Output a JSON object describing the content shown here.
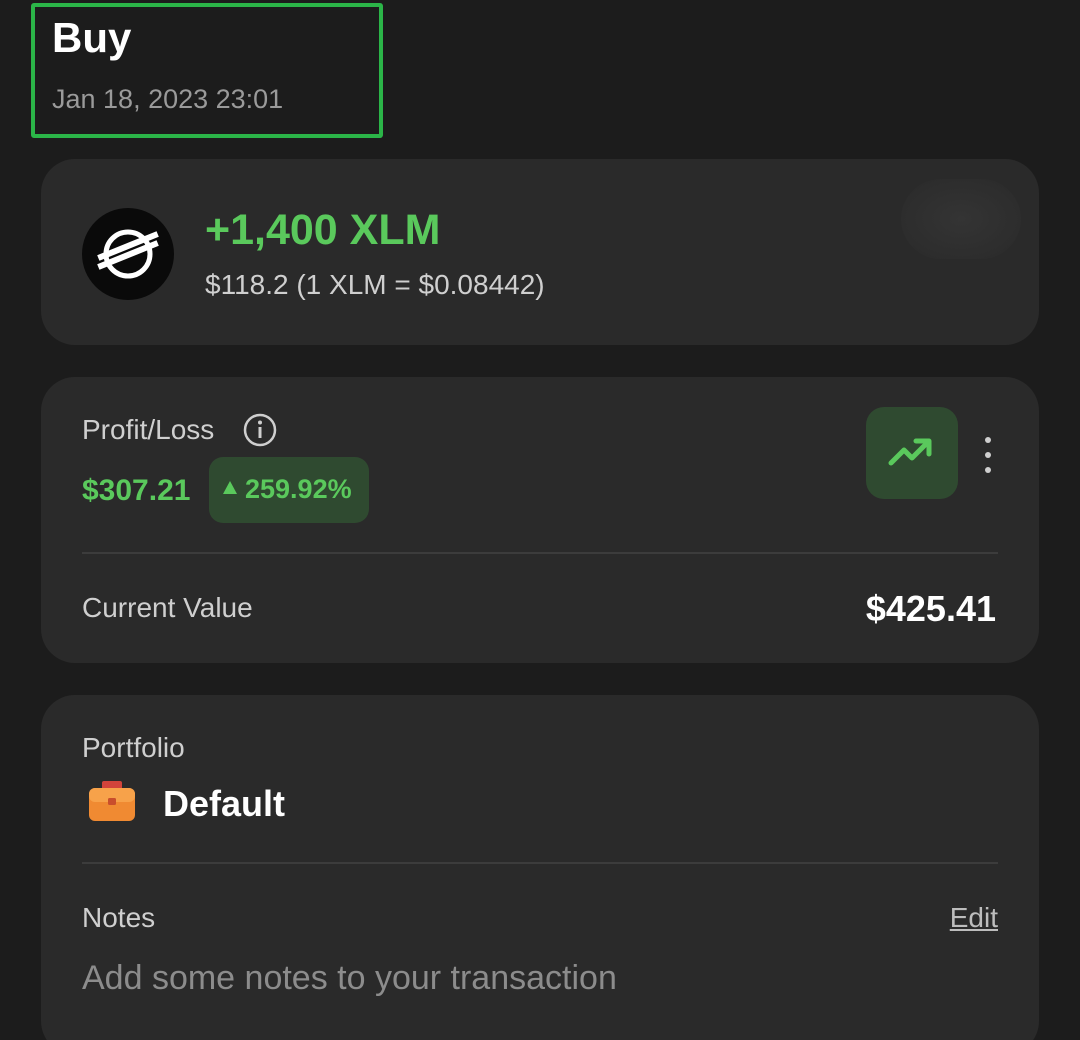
{
  "header": {
    "type": "Buy",
    "date": "Jan 18, 2023 23:01"
  },
  "asset": {
    "icon": "stellar-logo-icon",
    "amount": "+1,400 XLM",
    "subtitle": "$118.2 (1 XLM = $0.08442)"
  },
  "profit_loss": {
    "label": "Profit/Loss",
    "value": "$307.21",
    "change_pct": "259.92%",
    "change_direction": "up",
    "current_value_label": "Current Value",
    "current_value": "$425.41"
  },
  "portfolio": {
    "label": "Portfolio",
    "name": "Default",
    "icon": "briefcase-icon",
    "notes_label": "Notes",
    "edit_label": "Edit",
    "notes_placeholder": "Add some notes to your transaction"
  },
  "colors": {
    "highlight_border": "#2bb548",
    "positive": "#5ac95c",
    "card_bg": "#2a2a2a",
    "page_bg": "#1c1c1c"
  }
}
